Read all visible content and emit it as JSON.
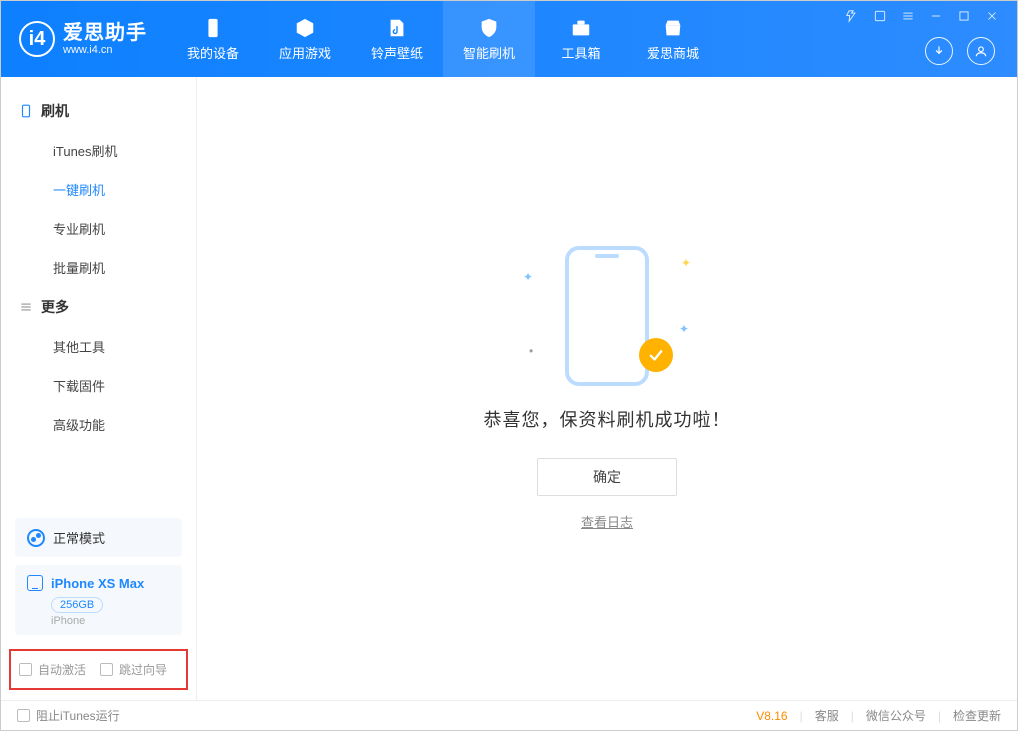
{
  "app": {
    "title": "爱思助手",
    "subtitle": "www.i4.cn"
  },
  "nav": {
    "items": [
      {
        "label": "我的设备"
      },
      {
        "label": "应用游戏"
      },
      {
        "label": "铃声壁纸"
      },
      {
        "label": "智能刷机"
      },
      {
        "label": "工具箱"
      },
      {
        "label": "爱思商城"
      }
    ],
    "active_index": 3
  },
  "sidebar": {
    "group1": {
      "header": "刷机",
      "items": [
        "iTunes刷机",
        "一键刷机",
        "专业刷机",
        "批量刷机"
      ],
      "active_index": 1
    },
    "group2": {
      "header": "更多",
      "items": [
        "其他工具",
        "下载固件",
        "高级功能"
      ]
    },
    "mode_label": "正常模式",
    "device": {
      "name": "iPhone XS Max",
      "capacity": "256GB",
      "type": "iPhone"
    },
    "checkboxes": {
      "auto_activate": "自动激活",
      "skip_guide": "跳过向导"
    }
  },
  "main": {
    "success_text": "恭喜您，保资料刷机成功啦！",
    "ok_label": "确定",
    "log_link": "查看日志"
  },
  "footer": {
    "block_itunes": "阻止iTunes运行",
    "version": "V8.16",
    "links": [
      "客服",
      "微信公众号",
      "检查更新"
    ]
  }
}
